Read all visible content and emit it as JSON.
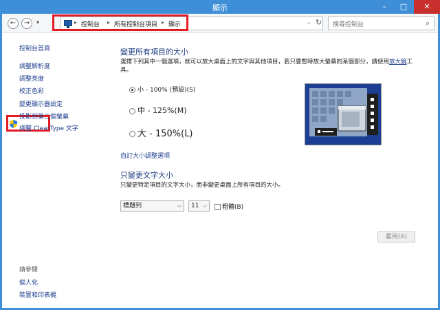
{
  "window": {
    "title": "顯示",
    "minimize_glyph": "–",
    "maximize_glyph": "□",
    "close_glyph": "✕"
  },
  "nav": {
    "back_glyph": "←",
    "forward_glyph": "→",
    "recent_glyph": "▾",
    "breadcrumb": [
      "控制台",
      "所有控制台項目",
      "顯示"
    ],
    "separator": "▸",
    "dropdown_glyph": "⌵",
    "refresh_glyph": "↻",
    "search_placeholder": "搜尋控制台",
    "search_glyph": "⌕"
  },
  "sidebar": {
    "links": [
      "控制台首頁",
      "調整解析度",
      "調整亮度",
      "校正色彩",
      "變更顯示器設定",
      "投影到第二個螢幕",
      "調整 ClearType 文字"
    ],
    "see_also_label": "請參閱",
    "see_also_links": [
      "個人化",
      "裝置和印表機"
    ]
  },
  "main": {
    "heading1": "變更所有項目的大小",
    "desc1": "選擇下列其中一個選項，就可以放大桌面上的文字與其他項目，若只要暫時放大螢幕的某個部分，請使用",
    "desc1_link": "放大鏡",
    "desc1_tail": "工具。",
    "options": [
      {
        "label": "小 - 100% (預設)(S)",
        "checked": true
      },
      {
        "label": "中 - 125%(M)",
        "checked": false
      },
      {
        "label": "大 - 150%(L)",
        "checked": false
      }
    ],
    "custom_link": "自訂大小調整選項",
    "heading2": "只變更文字大小",
    "desc2": "只變更特定項目的文字大小，而非變更桌面上所有項目的大小。",
    "item_select": "標題列",
    "size_select": "11",
    "bold_label": "粗體(B)",
    "dropdown_glyph": "⌵",
    "apply_label": "套用(A)"
  },
  "colors": {
    "titlebar": "#3f8fd8",
    "link": "#1f3f8e",
    "heading": "#1e3d80",
    "highlight": "#e21b22",
    "preview_bg": "#1d3f93"
  }
}
